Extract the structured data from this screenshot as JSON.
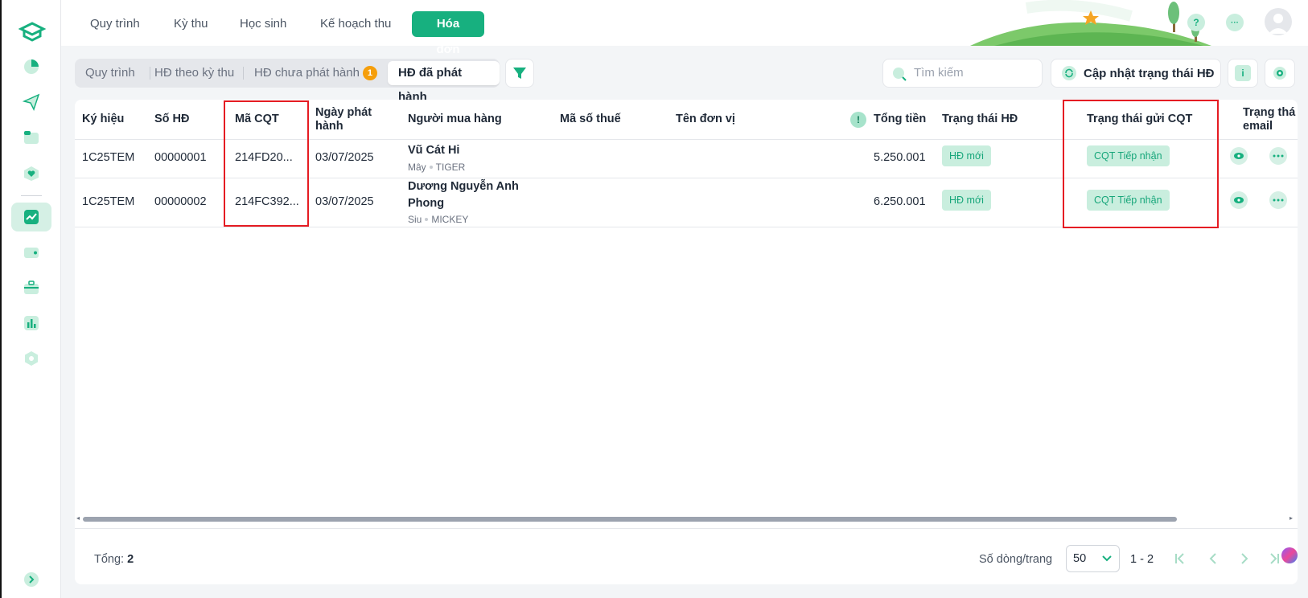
{
  "top_nav": {
    "tabs": [
      {
        "label": "Quy trình"
      },
      {
        "label": "Kỳ thu"
      },
      {
        "label": "Học sinh"
      },
      {
        "label": "Kế hoạch thu"
      },
      {
        "label": "Hóa đơn",
        "active": true
      }
    ],
    "help_label": "?",
    "more_label": "···"
  },
  "sub_tabs": {
    "items": [
      "Quy trình",
      "HĐ theo kỳ thu",
      "HĐ chưa phát hành",
      "HĐ đã phát hành"
    ],
    "unissued_badge": "1",
    "active": "HĐ đã phát hành"
  },
  "toolbar": {
    "search_placeholder": "Tìm kiếm",
    "update_status_label": "Cập nhật trạng thái HĐ",
    "info_label": "i"
  },
  "table": {
    "headers": {
      "symbol": "Ký hiệu",
      "invoice_no": "Số HĐ",
      "tax_code_cqt": "Mã CQT",
      "issue_date_1": "Ngày phát",
      "issue_date_2": "hành",
      "buyer": "Người mua hàng",
      "tax_id": "Mã số thuế",
      "unit_name": "Tên đơn vị",
      "warning": "!",
      "total": "Tổng tiền",
      "invoice_status": "Trạng thái HĐ",
      "cqt_status": "Trạng thái gửi CQT",
      "email_status_1": "Trạng thá",
      "email_status_2": "email"
    },
    "rows": [
      {
        "symbol": "1C25TEM",
        "invoice_no": "00000001",
        "tax_code_cqt": "214FD20...",
        "issue_date": "03/07/2025",
        "buyer_name_1": "Vũ Cát Hi",
        "buyer_name_2": "",
        "buyer_sub_1": "Mây",
        "buyer_sub_2": "TIGER",
        "total": "5.250.001",
        "invoice_status": "HĐ mới",
        "cqt_status": "CQT Tiếp nhận"
      },
      {
        "symbol": "1C25TEM",
        "invoice_no": "00000002",
        "tax_code_cqt": "214FC392...",
        "issue_date": "03/07/2025",
        "buyer_name_1": "Dương Nguyễn Anh",
        "buyer_name_2": "Phong",
        "buyer_sub_1": "Siu",
        "buyer_sub_2": "MICKEY",
        "total": "6.250.001",
        "invoice_status": "HĐ mới",
        "cqt_status": "CQT Tiếp nhận"
      }
    ]
  },
  "footer": {
    "total_label": "Tổng:",
    "total_value": "2",
    "rows_per_page_label": "Số dòng/trang",
    "rows_per_page_value": "50",
    "range": "1 - 2"
  },
  "colors": {
    "accent": "#17b07f",
    "highlight": "#e51c23",
    "badge": "#f59e0b"
  }
}
